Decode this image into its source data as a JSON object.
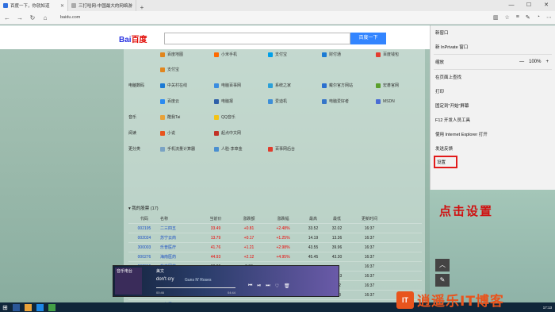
{
  "browser": {
    "tabs": [
      {
        "title": "百度一下，你就知道",
        "active": true
      },
      {
        "title": "三打哈网-中国最大的网络游",
        "active": false
      }
    ],
    "url": "baidu.com",
    "window_buttons": [
      "—",
      "☐",
      "✕"
    ]
  },
  "baidu": {
    "logo_a": "Bai",
    "logo_b": "百度",
    "search_button": "百度一下"
  },
  "categories": [
    {
      "name": "",
      "links": [
        "百度地图",
        "小米手机",
        "支付宝",
        "财付通",
        "百度钱包"
      ]
    },
    {
      "name": "",
      "links": [
        "支付宝"
      ]
    },
    {
      "name": "电脑数码",
      "links": [
        "中关村在线",
        "电脑百事网",
        "系统之家",
        "戴尔官方网站",
        "宏碁官网"
      ]
    },
    {
      "name": "",
      "links": [
        "百度云",
        "电脑报",
        "爱迪机",
        "电脑爱好者",
        "MSDN"
      ]
    },
    {
      "name": "音乐",
      "links": [
        "酷我Tai",
        "QQ音乐"
      ]
    },
    {
      "name": "阅读",
      "links": [
        "小说",
        "起点中文网"
      ]
    },
    {
      "name": "更分类",
      "links": [
        "手机流量计算器",
        "人脸·李章金",
        "百事网后台"
      ]
    }
  ],
  "stocks": {
    "title": "我的股票",
    "count": "(17)",
    "headers": [
      "代码",
      "名称",
      "当前价",
      "涨跌额",
      "涨跌幅",
      "最高",
      "最低",
      "更新时间"
    ],
    "rows": [
      [
        "002195",
        "二三四五",
        "33.49",
        "+0.81",
        "+2.48%",
        "33.52",
        "32.02",
        "16:37"
      ],
      [
        "002024",
        "苏宁云商",
        "13.79",
        "+0.17",
        "+1.25%",
        "14.19",
        "13.36",
        "16:37"
      ],
      [
        "300003",
        "乐普医疗",
        "41.76",
        "+1.21",
        "+2.98%",
        "43.55",
        "39.96",
        "16:37"
      ],
      [
        "000276",
        "海南医药",
        "44.93",
        "+2.12",
        "+4.95%",
        "45.45",
        "43.30",
        "16:37"
      ],
      [
        "002310",
        "东方园林",
        "38.30",
        "0.00",
        "",
        "",
        "-",
        "16:37"
      ],
      [
        "",
        "",
        "",
        "",
        "",
        "",
        "12.83",
        "16:37"
      ],
      [
        "",
        "",
        "",
        "",
        "",
        "",
        "9.22",
        "16:37"
      ],
      [
        "",
        "",
        "",
        "",
        "",
        "",
        "1.68",
        "16:37"
      ],
      [
        "600789",
        "万年青",
        "7.36",
        "-0.01",
        "-0.13%",
        "",
        "",
        "16:37"
      ]
    ]
  },
  "player": {
    "cover_text": "音乐电台",
    "title": "美文",
    "song": "don't cry",
    "artist": "Guns N' Roses",
    "time_left": "00:46",
    "time_right": "04:44"
  },
  "menu": {
    "items": [
      "新窗口",
      "新 InPrivate 窗口"
    ],
    "zoom_label": "缩放",
    "zoom_minus": "—",
    "zoom_value": "100%",
    "zoom_plus": "+",
    "items2": [
      "在页面上查找",
      "打印",
      "固定到\"开始\"屏幕",
      "F12 开发人员工具",
      "使用 Internet Explorer 打开",
      "发送反馈"
    ],
    "settings": "设置"
  },
  "annotation": "点击设置",
  "taskbar": {
    "time": "17:13"
  },
  "watermark": {
    "logo": "IT",
    "text": "逍遥乐IT博客"
  },
  "colors": {
    "accent": "#3385ff",
    "highlight": "#e21b1b",
    "taskbar": "#10263a"
  }
}
